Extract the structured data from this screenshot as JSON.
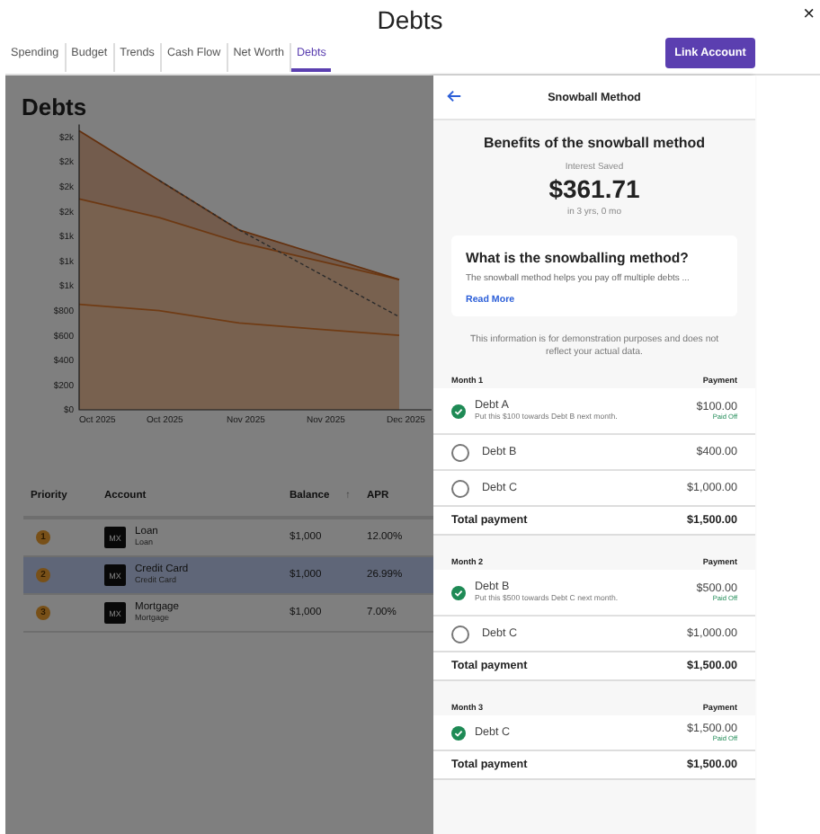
{
  "window": {
    "title": "Debts",
    "close": "×"
  },
  "tabs": [
    {
      "label": "Spending",
      "selected": false
    },
    {
      "label": "Budget",
      "selected": false
    },
    {
      "label": "Trends",
      "selected": false
    },
    {
      "label": "Cash Flow",
      "selected": false
    },
    {
      "label": "Net Worth",
      "selected": false
    },
    {
      "label": "Debts",
      "selected": true
    }
  ],
  "link_button": "Link Account",
  "page": {
    "heading": "Debts",
    "chart_data": {
      "type": "area",
      "stacked": true,
      "categories": [
        "Oct 2025",
        "Oct 2025",
        "Nov 2025",
        "Nov 2025",
        "Dec 2025"
      ],
      "yticks": [
        {
          "value": 0,
          "label": "$0"
        },
        {
          "value": 200,
          "label": "$200"
        },
        {
          "value": 400,
          "label": "$400"
        },
        {
          "value": 600,
          "label": "$600"
        },
        {
          "value": 800,
          "label": "$800"
        },
        {
          "value": 1000,
          "label": "$1k"
        },
        {
          "value": 1200,
          "label": "$1k"
        },
        {
          "value": 1400,
          "label": "$1k"
        },
        {
          "value": 1600,
          "label": "$2k"
        },
        {
          "value": 1800,
          "label": "$2k"
        },
        {
          "value": 2000,
          "label": "$2k"
        },
        {
          "value": 2200,
          "label": "$2k"
        }
      ],
      "ylim": [
        0,
        2300
      ],
      "series": [
        {
          "color": "#e0782a",
          "values": [
            850,
            800,
            700,
            650,
            600
          ]
        },
        {
          "color": "#e0782a",
          "values": [
            850,
            750,
            650,
            550,
            450
          ]
        },
        {
          "color": "#c8621e",
          "values": [
            550,
            300,
            100,
            50,
            0
          ]
        },
        {
          "type": "line",
          "line_style": "dashed",
          "color": "#555555",
          "values": [
            null,
            1850,
            1450,
            1100,
            750
          ]
        }
      ]
    },
    "table": {
      "columns": [
        "Priority",
        "Account",
        "Balance",
        "APR"
      ],
      "sort_icon": "↑",
      "rows": [
        {
          "priority": "1",
          "logo": "MX",
          "name": "Loan",
          "type": "Loan",
          "balance": "$1,000",
          "apr": "12.00%",
          "selected": false
        },
        {
          "priority": "2",
          "logo": "MX",
          "name": "Credit Card",
          "type": "Credit Card",
          "balance": "$1,000",
          "apr": "26.99%",
          "selected": true
        },
        {
          "priority": "3",
          "logo": "MX",
          "name": "Mortgage",
          "type": "Mortgage",
          "balance": "$1,000",
          "apr": "7.00%",
          "selected": false
        }
      ]
    }
  },
  "drawer": {
    "title": "Snowball Method",
    "heading": "Benefits of the snowball method",
    "saved_label": "Interest Saved",
    "saved": "$361.71",
    "period": "in 3 yrs, 0 mo",
    "card": {
      "title": "What is the snowballing method?",
      "text": "The snowball method helps you pay off multiple debts ...",
      "link": "Read More"
    },
    "disclaimer": "This information is for demonstration purposes and does not reflect your actual data.",
    "months": [
      {
        "label": "Month 1",
        "payment_label": "Payment",
        "total_label": "Total payment",
        "total": "$1,500.00",
        "debts": [
          {
            "name": "Debt A",
            "note": "Put this $100 towards Debt B next month.",
            "amount": "$100.00",
            "status": "Paid Off",
            "checked": true
          },
          {
            "name": "Debt B",
            "amount": "$400.00",
            "checked": false
          },
          {
            "name": "Debt C",
            "amount": "$1,000.00",
            "checked": false
          }
        ]
      },
      {
        "label": "Month 2",
        "payment_label": "Payment",
        "total_label": "Total payment",
        "total": "$1,500.00",
        "debts": [
          {
            "name": "Debt B",
            "note": "Put this $500 towards Debt C next month.",
            "amount": "$500.00",
            "status": "Paid Off",
            "checked": true
          },
          {
            "name": "Debt C",
            "amount": "$1,000.00",
            "checked": false
          }
        ]
      },
      {
        "label": "Month 3",
        "payment_label": "Payment",
        "total_label": "Total payment",
        "total": "$1,500.00",
        "debts": [
          {
            "name": "Debt C",
            "amount": "$1,500.00",
            "status": "Paid Off",
            "checked": true
          }
        ]
      }
    ]
  }
}
